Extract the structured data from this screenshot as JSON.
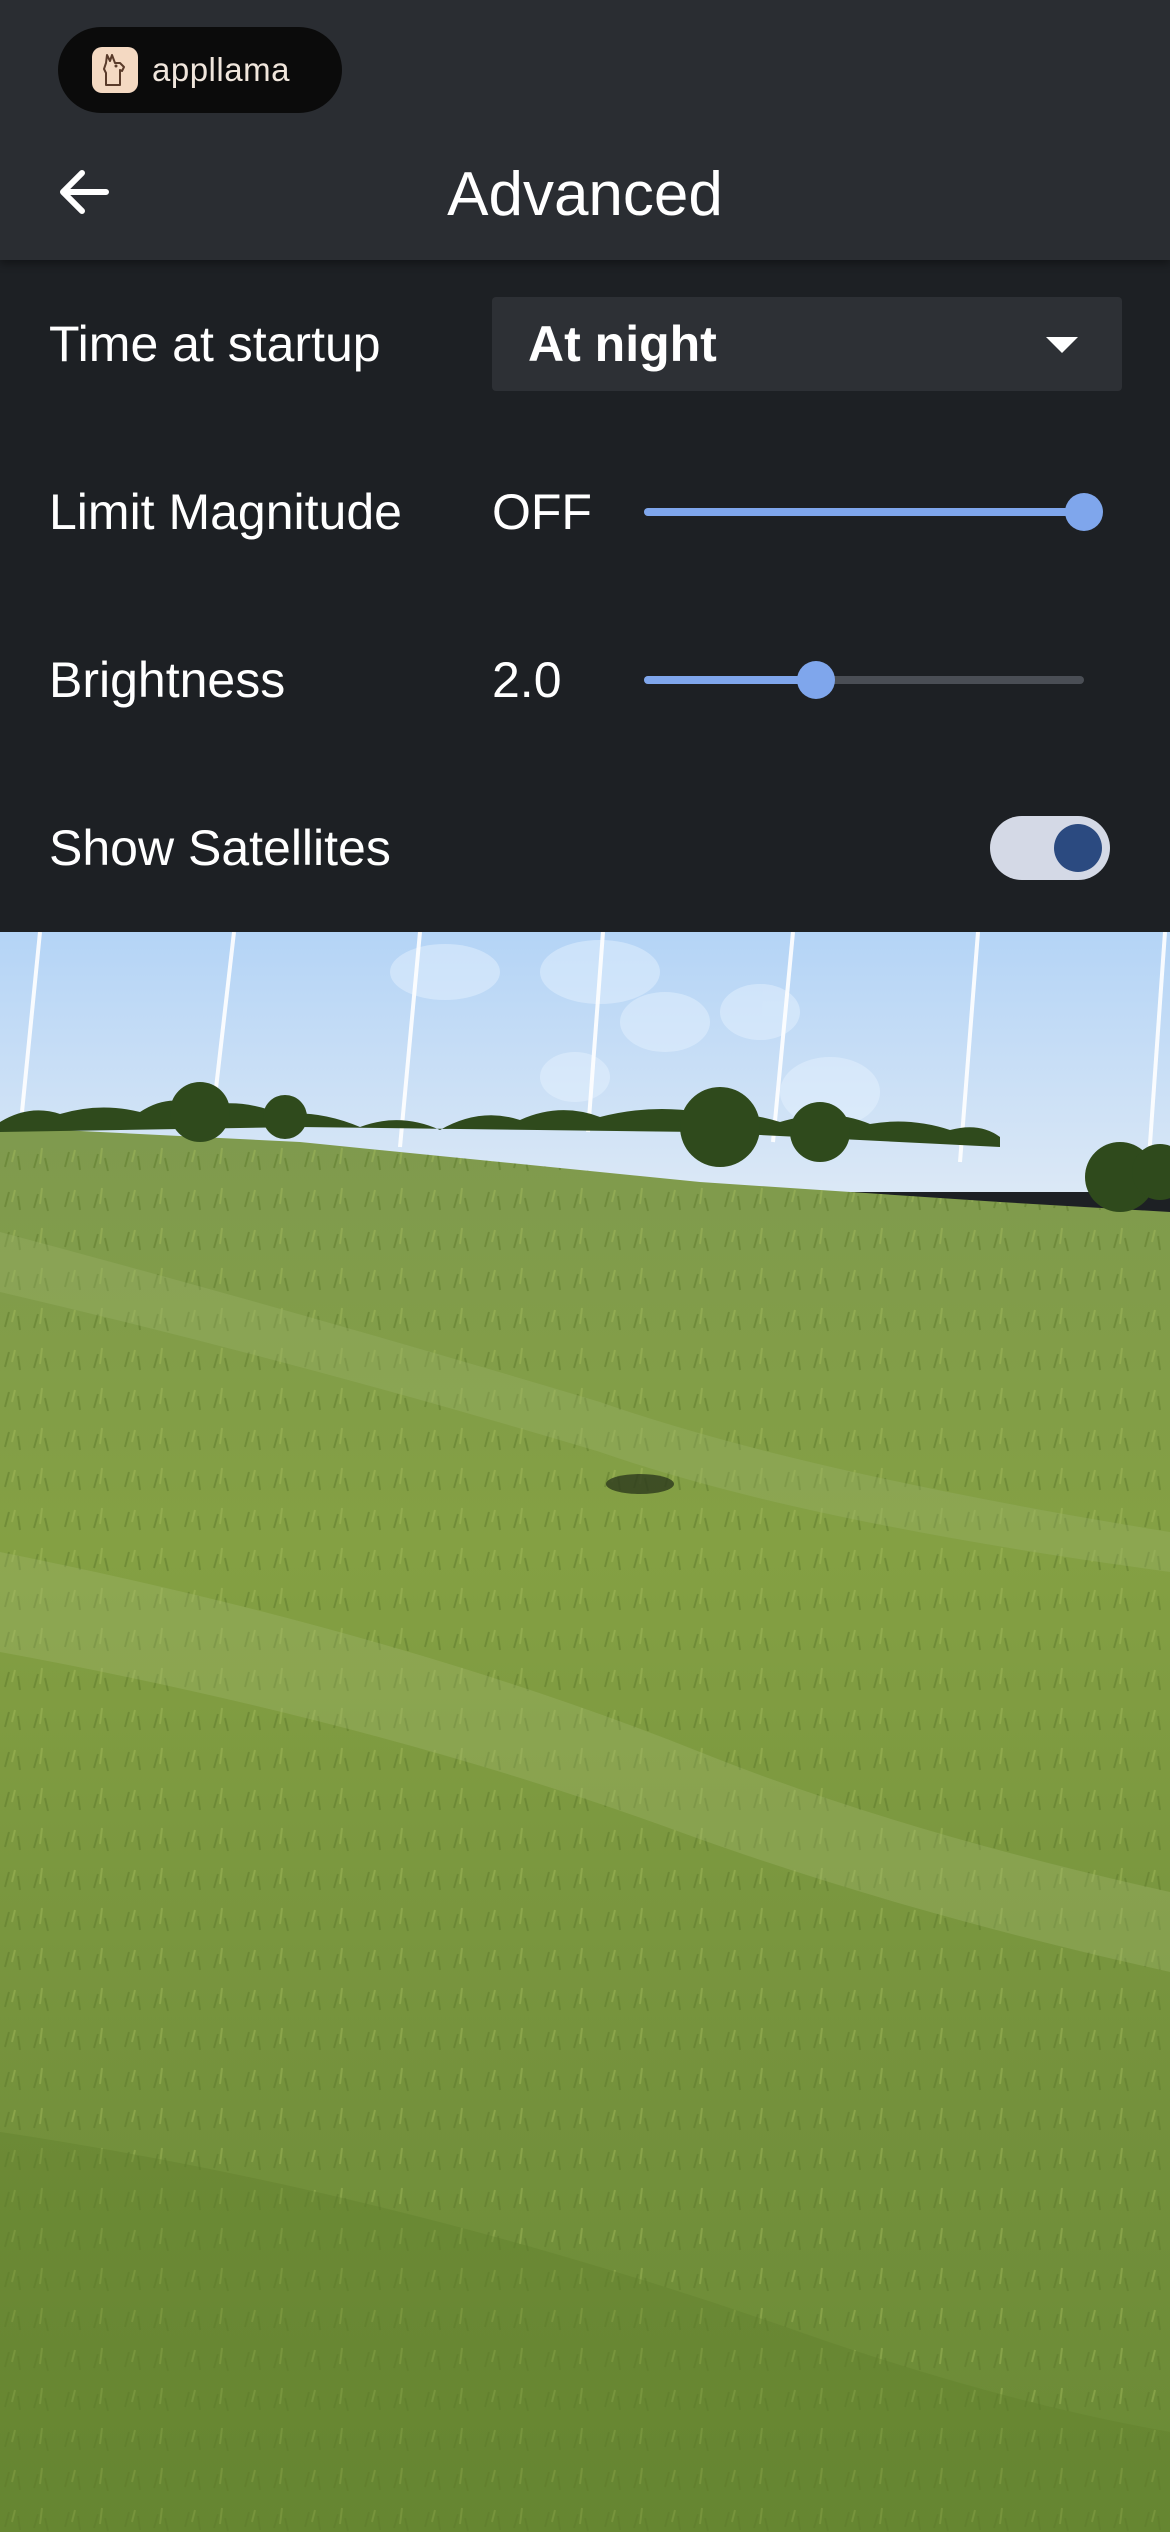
{
  "brand": {
    "name": "appllama",
    "logo_icon": "llama-logo-icon"
  },
  "header": {
    "title": "Advanced",
    "back_icon": "arrow-left-icon"
  },
  "settings": {
    "time_at_startup": {
      "label": "Time at startup",
      "selected": "At night"
    },
    "limit_magnitude": {
      "label": "Limit Magnitude",
      "value": "OFF",
      "level": 1.0
    },
    "brightness": {
      "label": "Brightness",
      "value": "2.0",
      "level": 0.39
    },
    "show_satellites": {
      "label": "Show Satellites",
      "enabled": true
    }
  },
  "colors": {
    "header_bg": "#2a2d32",
    "panel_bg": "#1d2024",
    "accent": "#7fa6ec",
    "toggle_track": "#d4d9e6",
    "toggle_knob": "#2b4a80"
  },
  "scene": {
    "description_icon": "camera-ar-view"
  }
}
